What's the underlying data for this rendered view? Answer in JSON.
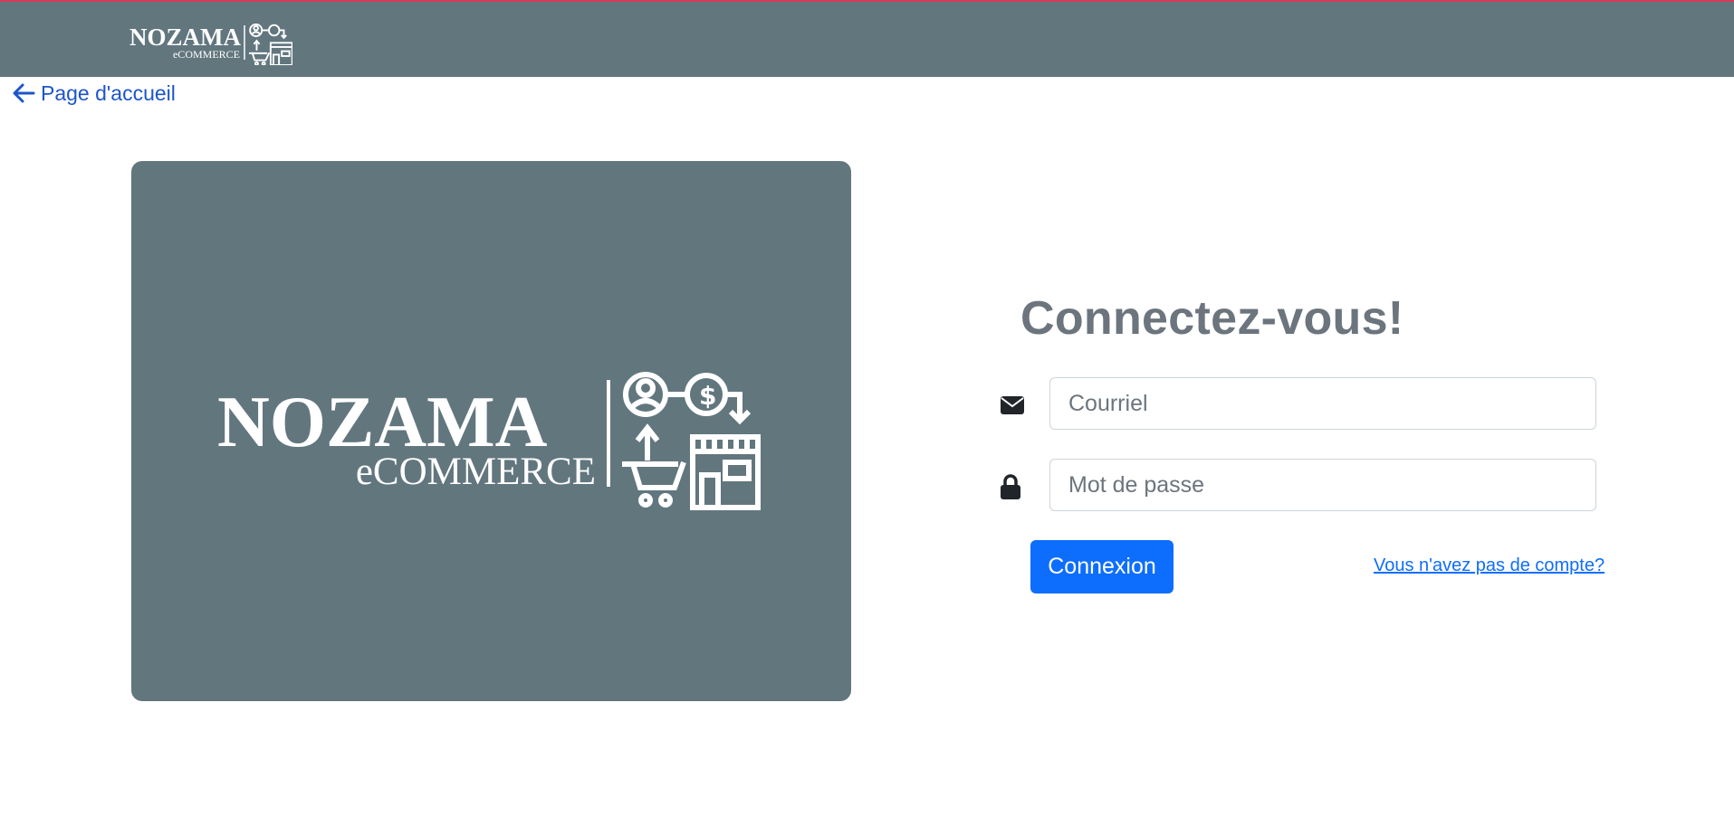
{
  "brand": {
    "name": "NOZAMA",
    "tagline": "eCOMMERCE"
  },
  "nav": {
    "back_label": "Page d'accueil"
  },
  "login": {
    "title": "Connectez-vous!",
    "email_placeholder": "Courriel",
    "email_value": "",
    "password_placeholder": "Mot de passe",
    "password_value": "",
    "submit_label": "Connexion",
    "signup_link": "Vous n'avez pas de compte?"
  },
  "colors": {
    "navbar": "#62767e",
    "accent": "#0d6efd",
    "title": "#6c757d",
    "top_border": "#d63a5a"
  },
  "icons": [
    "logo-icon",
    "arrow-left-icon",
    "envelope-icon",
    "lock-icon"
  ]
}
